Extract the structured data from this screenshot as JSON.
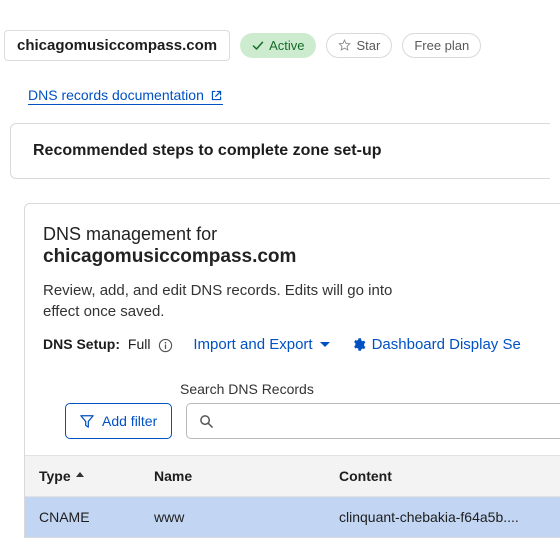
{
  "header": {
    "domain": "chicagomusiccompass.com",
    "status": "Active",
    "star_label": "Star",
    "plan_label": "Free plan"
  },
  "docs_link": "DNS records documentation",
  "setup_panel": {
    "title": "Recommended steps to complete zone set-up"
  },
  "dns": {
    "title_prefix": "DNS management for",
    "title_domain": "chicagomusiccompass.com",
    "description": "Review, add, and edit DNS records. Edits will go into effect once saved.",
    "setup_label": "DNS Setup:",
    "setup_value": "Full",
    "import_export": "Import and Export",
    "dashboard_display": "Dashboard Display Se"
  },
  "search": {
    "label": "Search DNS Records",
    "placeholder": "",
    "add_filter": "Add filter"
  },
  "table": {
    "headers": {
      "type": "Type",
      "name": "Name",
      "content": "Content"
    },
    "rows": [
      {
        "type": "CNAME",
        "name": "www",
        "content": "clinquant-chebakia-f64a5b...."
      }
    ]
  }
}
